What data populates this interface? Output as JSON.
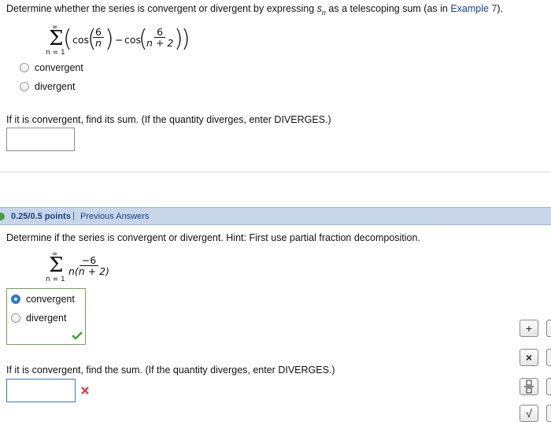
{
  "q1": {
    "prompt_before": "Determine whether the series is convergent or divergent by expressing ",
    "prompt_var": "s",
    "prompt_sub": "n",
    "prompt_after": " as a telescoping sum (as in ",
    "prompt_link": "Example 7",
    "prompt_end": ").",
    "series": {
      "sum_top": "∞",
      "sum_bottom": "n = 1",
      "cos1": "cos",
      "frac1_num": "6",
      "frac1_den": "n",
      "minus": "−",
      "cos2": "cos",
      "frac2_num": "6",
      "frac2_den": "n + 2"
    },
    "options": [
      "convergent",
      "divergent"
    ],
    "sum_prompt": "If it is convergent, find its sum. (If the quantity diverges, enter DIVERGES.)",
    "answer_value": ""
  },
  "q2": {
    "points": "0.25/0.5 points",
    "separator": "|",
    "previous_answers": "Previous Answers",
    "prompt": "Determine if the series is convergent or divergent. Hint: First use partial fraction decomposition.",
    "series": {
      "sum_top": "∞",
      "sum_bottom": "n = 1",
      "num": "−6",
      "den": "n(n + 2)"
    },
    "options": [
      "convergent",
      "divergent"
    ],
    "selected_option": "convergent",
    "sum_prompt": "If it is convergent, find the sum. (If the quantity diverges, enter DIVERGES.)",
    "answer_value": ""
  },
  "toolbar": {
    "plus": "+",
    "times": "×",
    "fraction_icon": "fraction-icon",
    "sqrt": "√"
  },
  "colors": {
    "bar": "#c7d6ea",
    "link": "#1a3fa6",
    "correct": "#4a9d3a",
    "incorrect": "#d04a4a",
    "selected_radio": "#2f78c4"
  }
}
